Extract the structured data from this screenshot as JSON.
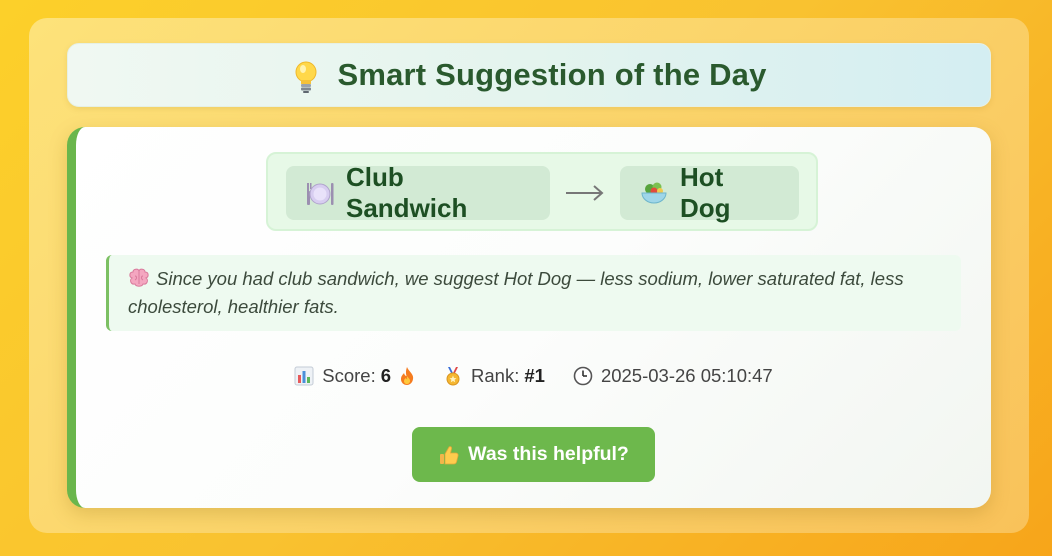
{
  "header": {
    "title": "Smart Suggestion of the Day",
    "icon": "lightbulb-icon"
  },
  "suggestion": {
    "from_food": "Club Sandwich",
    "from_icon": "plate-icon",
    "to_food": "Hot Dog",
    "to_icon": "salad-bowl-icon",
    "arrow_icon": "right-arrow-icon"
  },
  "note": {
    "icon": "brain-icon",
    "text": "Since you had club sandwich, we suggest Hot Dog — less sodium, lower saturated fat, less cholesterol, healthier fats."
  },
  "meta": {
    "score_label": "Score:",
    "score_value": "6",
    "rank_label": "Rank:",
    "rank_value": "#1",
    "timestamp": "2025-03-26 05:10:47"
  },
  "feedback": {
    "button_label": "Was this helpful?",
    "icon": "thumbs-up-icon"
  },
  "colors": {
    "accent_green": "#6db84c",
    "title_green": "#2a5a2e",
    "background_yellow": "#f9c230"
  }
}
